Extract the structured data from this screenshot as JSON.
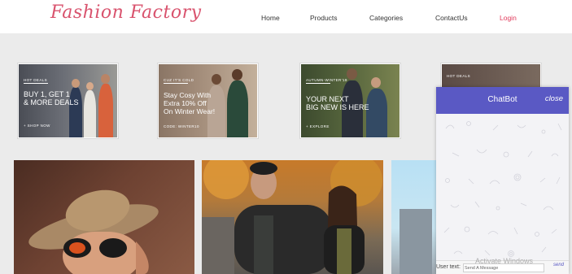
{
  "header": {
    "logo": "Fashion Factory",
    "nav": [
      {
        "label": "Home"
      },
      {
        "label": "Products"
      },
      {
        "label": "Categories"
      },
      {
        "label": "ContactUs"
      },
      {
        "label": "Login"
      }
    ]
  },
  "promos": [
    {
      "tag": "HOT DEALS",
      "headline": "BUY 1, GET 1\n& MORE DEALS",
      "cta": "+ SHOP NOW"
    },
    {
      "tag": "CUZ IT'S COLD",
      "headline": "Stay Cosy With\nExtra 10% Off\nOn Winter Wear!",
      "cta": "CODE: WINTER10"
    },
    {
      "tag": "AUTUMN-WINTER'19",
      "headline": "YOUR NEXT\nBIG NEW IS HERE",
      "cta": "+ EXPLORE"
    },
    {
      "tag": "HOT DEALS",
      "headline": "",
      "cta": ""
    }
  ],
  "chatbot": {
    "title": "ChatBot",
    "close_label": "close",
    "user_label": "User text:",
    "input_placeholder": "Send A Message",
    "send_label": "send"
  },
  "watermark": "Activate Windows",
  "colors": {
    "brand": "#d9536e",
    "login": "#e0395a",
    "chat_header": "#5a59c4",
    "page_bg": "#ebebeb"
  }
}
